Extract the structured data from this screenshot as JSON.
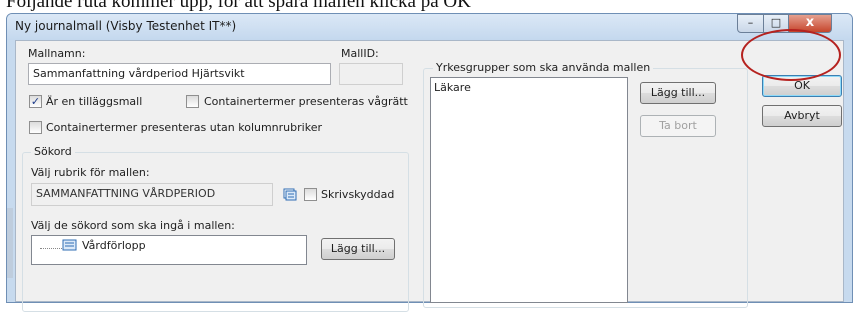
{
  "caption": "Följande ruta kommer upp, för att spara mallen klicka på OK",
  "window": {
    "title": "Ny journalmall (Visby Testenhet  IT**)",
    "min_glyph": "–",
    "max_glyph": "□",
    "close_glyph": "x"
  },
  "form": {
    "mallnamn_label": "Mallnamn:",
    "mallnamn_value": "Sammanfattning vårdperiod Hjärtsvikt",
    "mallid_label": "MallID:",
    "mallid_value": "",
    "tillaggsmall_label": "Är en tilläggsmall",
    "tillaggsmall_checked": true,
    "vagratt_label": "Containertermer presenteras vågrätt",
    "vagratt_checked": false,
    "utan_kolumn_label": "Containertermer presenteras utan kolumnrubriker",
    "utan_kolumn_checked": false
  },
  "sokord": {
    "group_title": "Sökord",
    "rubrik_label": "Välj rubrik för mallen:",
    "rubrik_value": "SAMMANFATTNING VÅRDPERIOD",
    "skrivskyddad_label": "Skrivskyddad",
    "skrivskyddad_checked": false,
    "sokord_label": "Välj de sökord som ska ingå i mallen:",
    "tree_items": [
      "Vårdförlopp"
    ],
    "add_button": "Lägg till..."
  },
  "yrkes": {
    "group_title": "Yrkesgrupper som ska använda mallen",
    "items": [
      "Läkare"
    ],
    "add_button": "Lägg till...",
    "remove_button": "Ta bort"
  },
  "actions": {
    "ok": "OK",
    "cancel": "Avbryt"
  },
  "colors": {
    "highlight_circle": "#b5221f",
    "window_frame": "#c7daee"
  }
}
